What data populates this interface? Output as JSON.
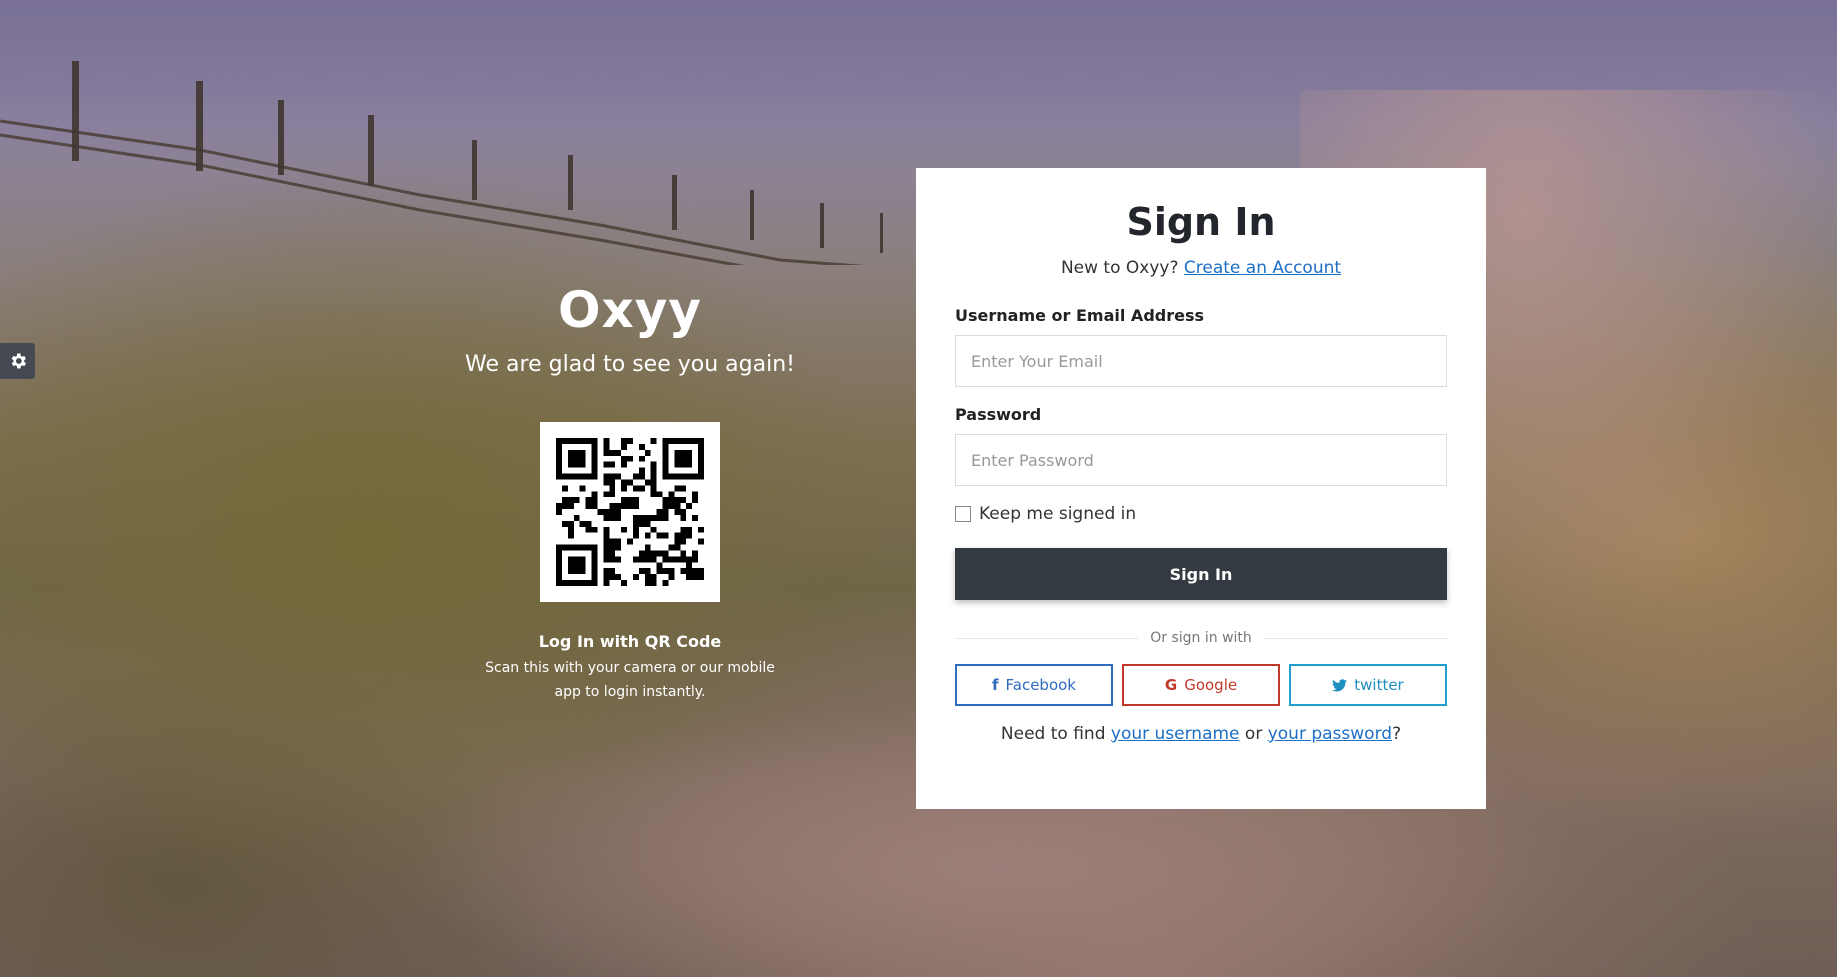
{
  "brand": {
    "logo_text": "Oxyy",
    "welcome": "We are glad to see you again!"
  },
  "qr": {
    "title": "Log In with QR Code",
    "description": "Scan this with your camera or our mobile app to login instantly."
  },
  "settings": {
    "icon": "gear-icon"
  },
  "signin": {
    "title": "Sign In",
    "new_prompt": "New to Oxyy?",
    "create_account_link": "Create an Account",
    "username_label": "Username or Email Address",
    "username_placeholder": "Enter Your Email",
    "password_label": "Password",
    "password_placeholder": "Enter Password",
    "keep_signed_in": "Keep me signed in",
    "submit_label": "Sign In",
    "or_sign_in_with": "Or sign in with",
    "social": {
      "facebook": "Facebook",
      "google": "Google",
      "twitter": "twitter"
    },
    "help_prefix": "Need to find",
    "username_link": "your username",
    "help_or": "or",
    "password_link": "your password",
    "help_suffix": "?"
  },
  "colors": {
    "card_bg": "#ffffff",
    "button_dark": "#343a42",
    "link": "#1d6ec5",
    "facebook": "#2f6bbf",
    "google": "#c0392b",
    "twitter": "#1fa0d0"
  }
}
